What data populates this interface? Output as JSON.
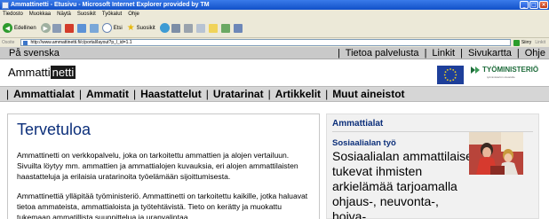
{
  "window": {
    "title": "Ammattinetti - Etusivu - Microsoft Internet Explorer provided by TM",
    "buttons": [
      "_",
      "□",
      "×"
    ]
  },
  "menubar": [
    "Tiedosto",
    "Muokkaa",
    "Näytä",
    "Suosikit",
    "Työkalut",
    "Ohje"
  ],
  "toolbar": {
    "back_label": "Edellinen",
    "search_label": "Etsi",
    "favorites_label": "Suosikit"
  },
  "addressbar": {
    "label": "Osoite",
    "url": "http://www.ammattinetti.fi/c/portal/layout?p_l_id=1.1",
    "go_label": "Siirry",
    "links_label": "Linkit"
  },
  "topnav": {
    "svenska": "På svenska",
    "links": [
      "Tietoa palvelusta",
      "Linkit",
      "Sivukartta",
      "Ohje"
    ],
    "separator": "|"
  },
  "header": {
    "logo_part1": "Ammatti",
    "logo_part2": "netti",
    "ministry_name": "TYÖMINISTERIÖ",
    "ministry_sub": "työministeriön sivustolle"
  },
  "mainnav": {
    "items": [
      "Ammattialat",
      "Ammatit",
      "Haastattelut",
      "Uratarinat",
      "Artikkelit",
      "Muut aineistot"
    ],
    "separator": "|"
  },
  "article": {
    "title": "Tervetuloa",
    "paragraphs": [
      "Ammattinetti on verkkopalvelu, joka on tarkoitettu ammattien ja alojen vertailuun. Sivuilta löytyy mm. ammattien ja ammattialojen kuvauksia, eri alojen ammattilaisten haastatteluja ja erilaisia uratarinoita työelämään sijoittumisesta.",
      "Ammattinettiä ylläpitää työministeriö. Ammattinetti on tarkoitettu kaikille, jotka haluavat tietoa ammateista, ammattialoista ja työtehtävistä. Tieto on kerätty ja muokattu tukemaan ammatillista suunnittelua ja uranvalintaa."
    ]
  },
  "sidepanel": {
    "title": "Ammattialat",
    "subtitle": "Sosiaalialan työ",
    "body": "Sosiaalialan ammattilaiset tukevat ihmisten arkielämää tarjoamalla ohjaus-, neuvonta-, hoiva-,"
  },
  "colors": {
    "heading_blue": "#0c2f7a",
    "nav_gray": "#d6d6d6",
    "topnav_gray": "#c9c9c9",
    "ministry_green": "#1d6b3a",
    "eu_blue": "#1e3f9a"
  }
}
